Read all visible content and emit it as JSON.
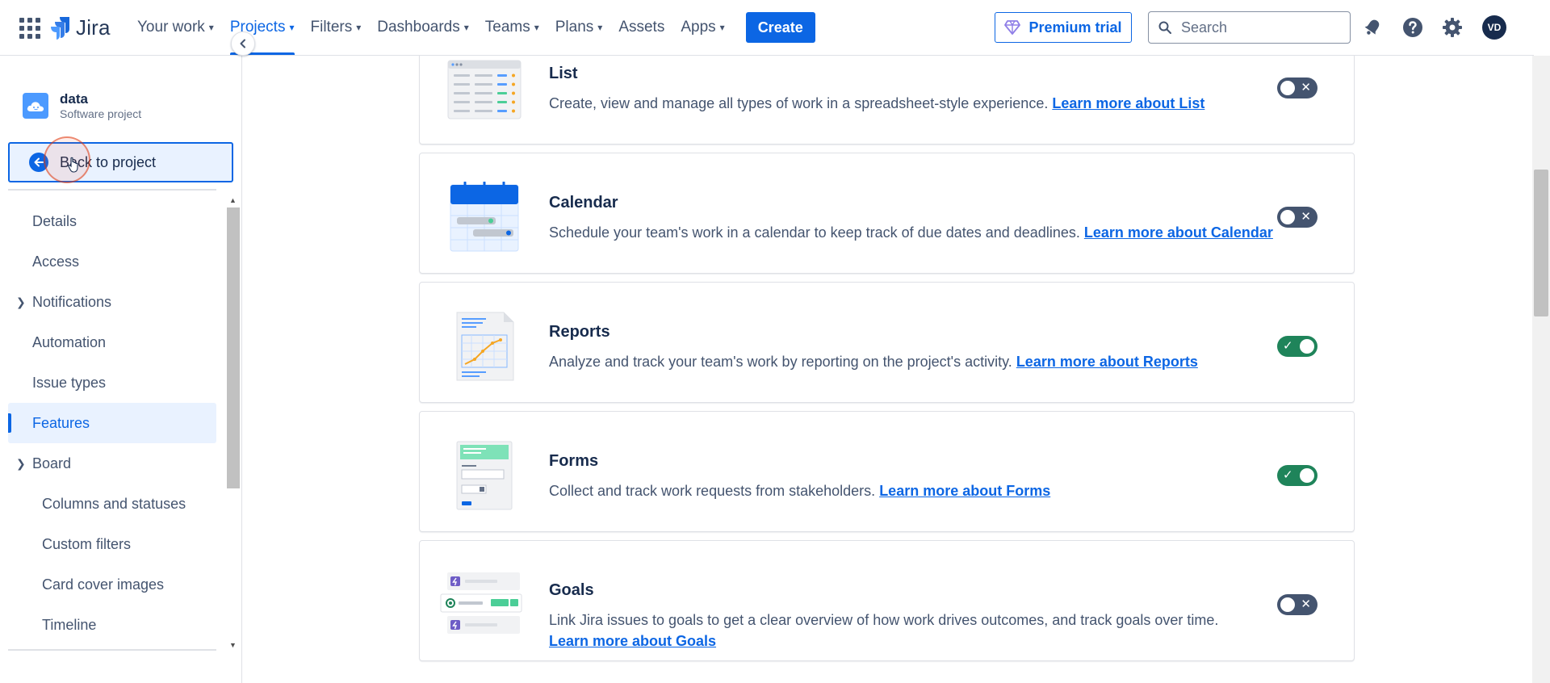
{
  "topnav": {
    "logo_text": "Jira",
    "items": [
      {
        "label": "Your work",
        "dropdown": true
      },
      {
        "label": "Projects",
        "dropdown": true,
        "active": true
      },
      {
        "label": "Filters",
        "dropdown": true
      },
      {
        "label": "Dashboards",
        "dropdown": true
      },
      {
        "label": "Teams",
        "dropdown": true
      },
      {
        "label": "Plans",
        "dropdown": true
      },
      {
        "label": "Assets",
        "dropdown": false
      },
      {
        "label": "Apps",
        "dropdown": true
      }
    ],
    "create_label": "Create",
    "premium_label": "Premium trial",
    "search_placeholder": "Search",
    "avatar_initials": "VD"
  },
  "sidebar": {
    "project_name": "data",
    "project_type": "Software project",
    "back_label": "Back to project",
    "items": [
      {
        "label": "Details"
      },
      {
        "label": "Access"
      },
      {
        "label": "Notifications",
        "expandable": "collapsed"
      },
      {
        "label": "Automation"
      },
      {
        "label": "Issue types"
      },
      {
        "label": "Features",
        "active": true
      },
      {
        "label": "Board",
        "expandable": "expanded"
      },
      {
        "label": "Columns and statuses",
        "sub": true
      },
      {
        "label": "Custom filters",
        "sub": true
      },
      {
        "label": "Card cover images",
        "sub": true
      },
      {
        "label": "Timeline",
        "sub": true
      }
    ]
  },
  "features": [
    {
      "id": "list",
      "title": "List",
      "desc": "Create, view and manage all types of work in a spreadsheet-style experience.",
      "link": "Learn more about List",
      "enabled": false
    },
    {
      "id": "calendar",
      "title": "Calendar",
      "desc": "Schedule your team's work in a calendar to keep track of due dates and deadlines.",
      "link": "Learn more about Calendar",
      "enabled": false
    },
    {
      "id": "reports",
      "title": "Reports",
      "desc": "Analyze and track your team's work by reporting on the project's activity.",
      "link": "Learn more about Reports",
      "enabled": true
    },
    {
      "id": "forms",
      "title": "Forms",
      "desc": "Collect and track work requests from stakeholders.",
      "link": "Learn more about Forms",
      "enabled": true
    },
    {
      "id": "goals",
      "title": "Goals",
      "desc": "Link Jira issues to goals to get a clear overview of how work drives outcomes, and track goals over time.",
      "link": "Learn more about Goals",
      "enabled": false
    }
  ],
  "colors": {
    "brand_blue": "#0C66E4",
    "toggle_on": "#1F845A",
    "toggle_off": "#44546F",
    "text": "#172B4D"
  },
  "icons": [
    "app-switcher-icon",
    "jira-logo-icon",
    "diamond-icon",
    "search-icon",
    "notifications-bell-icon",
    "help-icon",
    "settings-gear-icon",
    "back-arrow-icon",
    "chevron-left-icon",
    "chevron-right-icon",
    "chevron-down-icon",
    "check-icon",
    "cross-icon"
  ]
}
